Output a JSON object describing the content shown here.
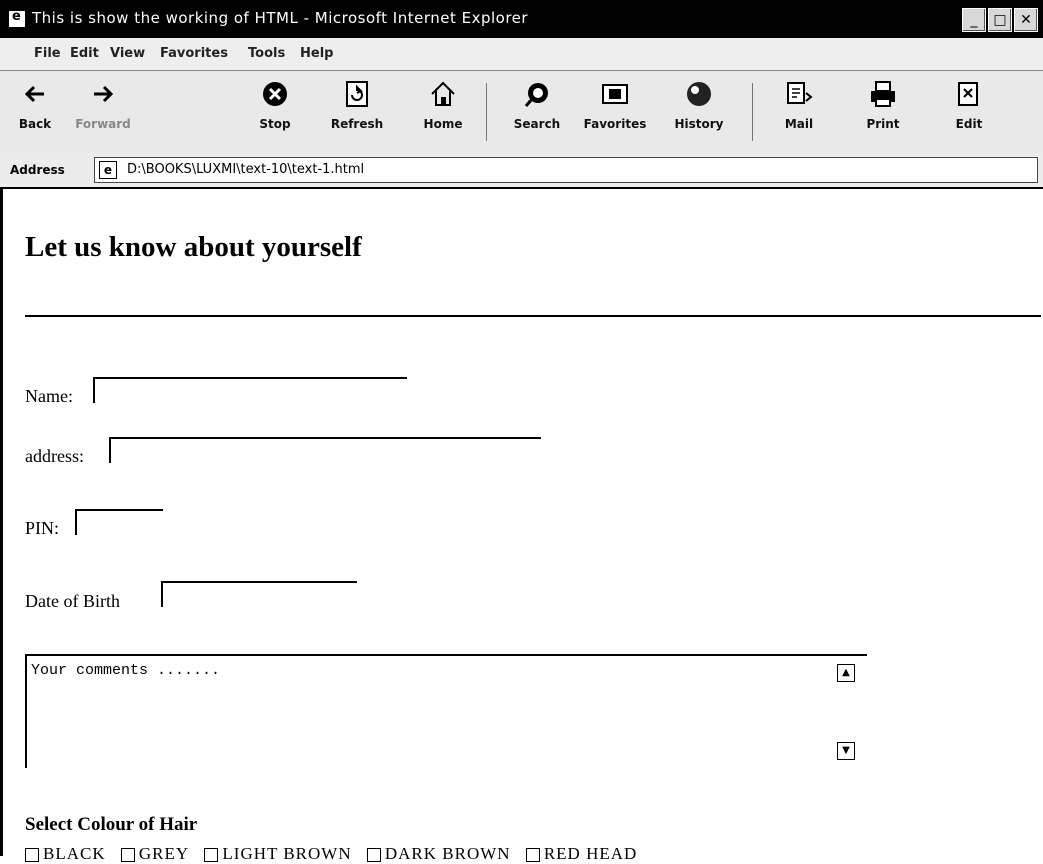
{
  "window": {
    "title": "This is show the working of HTML - Microsoft Internet Explorer",
    "controls": {
      "minimize": "_",
      "maximize": "□",
      "close": "✕"
    }
  },
  "menubar": [
    "File",
    "Edit",
    "View",
    "Favorites",
    "Tools",
    "Help"
  ],
  "toolbar": {
    "buttons": [
      {
        "label": "Back",
        "icon": "back-arrow-icon"
      },
      {
        "label": "Forward",
        "icon": "forward-arrow-icon"
      },
      {
        "label": "Stop",
        "icon": "stop-icon"
      },
      {
        "label": "Refresh",
        "icon": "refresh-icon"
      },
      {
        "label": "Home",
        "icon": "home-icon"
      },
      {
        "label": "Search",
        "icon": "search-icon"
      },
      {
        "label": "Favorites",
        "icon": "favorites-icon"
      },
      {
        "label": "History",
        "icon": "history-icon"
      },
      {
        "label": "Mail",
        "icon": "mail-icon"
      },
      {
        "label": "Print",
        "icon": "print-icon"
      },
      {
        "label": "Edit",
        "icon": "edit-icon"
      }
    ]
  },
  "addressbar": {
    "label": "Address",
    "url": "D:\\BOOKS\\LUXMI\\text-10\\text-1.html"
  },
  "page": {
    "heading": "Let us know about yourself",
    "fields": {
      "name_label": "Name:",
      "address_label": "address:",
      "pin_label": "PIN:",
      "dob_label": "Date of Birth"
    },
    "comments": "Your comments .......",
    "hair": {
      "title": "Select Colour of Hair",
      "options": [
        "BLACK",
        "GREY",
        "LIGHT BROWN",
        "DARK BROWN",
        "RED HEAD"
      ]
    }
  }
}
